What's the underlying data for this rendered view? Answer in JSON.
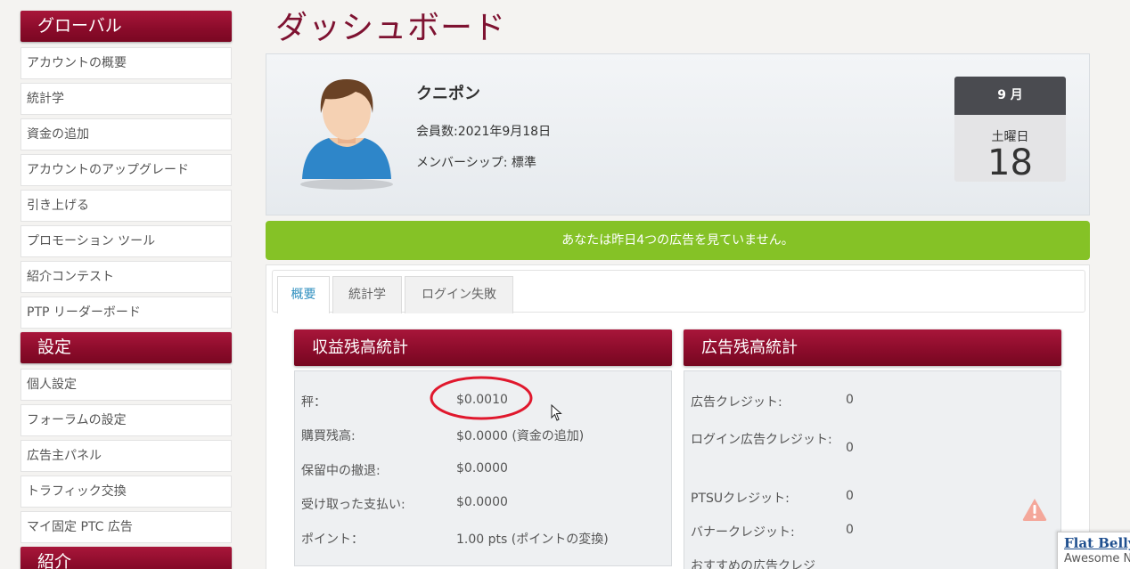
{
  "page_title": "ダッシュボード",
  "sidebar": {
    "sections": [
      {
        "title": "グローバル",
        "items": [
          "アカウントの概要",
          "統計学",
          "資金の追加",
          "アカウントのアップグレード",
          "引き上げる",
          "プロモーション ツール",
          "紹介コンテスト",
          "PTP リーダーボード"
        ]
      },
      {
        "title": "設定",
        "items": [
          "個人設定",
          "フォーラムの設定",
          "広告主パネル",
          "トラフィック交換",
          "マイ固定 PTC 広告"
        ]
      },
      {
        "title": "紹介",
        "items": []
      }
    ]
  },
  "profile": {
    "username": "クニポン",
    "member_since": "会員数:2021年9月18日",
    "membership": "メンバーシップ: 標準",
    "calendar": {
      "month": "9 月",
      "weekday": "土曜日",
      "day": "18"
    }
  },
  "alert": {
    "text": "あなたは昨日4つの広告を見ていません。",
    "color": "#85c226"
  },
  "tabs": [
    {
      "label": "概要",
      "active": true
    },
    {
      "label": "統計学",
      "active": false
    },
    {
      "label": "ログイン失敗",
      "active": false
    }
  ],
  "earnings_panel": {
    "title": "収益残高統計",
    "rows": [
      {
        "label": "秤：",
        "value": "$0.0010"
      },
      {
        "label": "購買残高:",
        "value": "$0.0000 (資金の追加)"
      },
      {
        "label": "保留中の撤退:",
        "value": "$0.0000"
      },
      {
        "label": "受け取った支払い:",
        "value": "$0.0000"
      },
      {
        "label": "ポイント：",
        "value": "1.00 pts (ポイントの変換)"
      }
    ]
  },
  "ads_panel": {
    "title": "広告残高統計",
    "rows": [
      {
        "label": "広告クレジット:",
        "value": "0"
      },
      {
        "label": "ログイン広告クレジット:",
        "value": "0"
      },
      {
        "label": "PTSUクレジット:",
        "value": "0"
      },
      {
        "label": "バナークレジット:",
        "value": "0"
      },
      {
        "label": "おすすめの広告クレジ",
        "value": ""
      }
    ]
  },
  "popup": {
    "title": "Flat Belly",
    "subtitle": "Awesome N"
  },
  "icons": {
    "warning": "warning-icon",
    "cursor": "mouse-cursor-icon",
    "avatar": "user-avatar"
  },
  "colors": {
    "brand": "#8a0b2a",
    "tab_active": "#2f8fbf",
    "annotation": "#e0182d"
  }
}
